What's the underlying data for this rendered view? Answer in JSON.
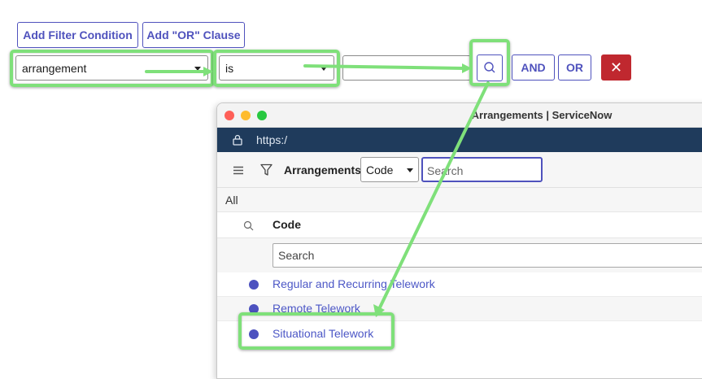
{
  "filter": {
    "add_condition_label": "Add Filter Condition",
    "add_or_label": "Add \"OR\" Clause",
    "field_value": "arrangement",
    "operator_value": "is",
    "value_input": "",
    "and_label": "AND",
    "or_label": "OR",
    "delete_label": "✕"
  },
  "popup": {
    "window_title": "Arrangements | ServiceNow",
    "url": "https:/",
    "list_title": "Arrangements",
    "search_field": "Code",
    "search_placeholder": "Search",
    "breadcrumb": "All",
    "column_header": "Code",
    "column_search_placeholder": "Search",
    "rows": [
      {
        "label": "Regular and Recurring Telework"
      },
      {
        "label": "Remote Telework"
      },
      {
        "label": "Situational Telework"
      }
    ]
  },
  "colors": {
    "accent": "#4f52bd",
    "highlight": "#7fe07a",
    "delete": "#c0282f",
    "header_bar": "#1f3b5c"
  }
}
